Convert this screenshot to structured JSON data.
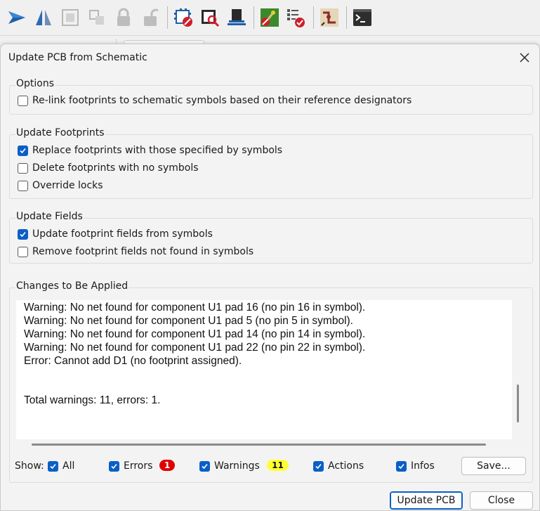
{
  "toolbar": {
    "icons": [
      "run-icon",
      "mirror-icon",
      "group-icon",
      "ungroup-icon",
      "lock-icon",
      "unlock-icon",
      "footprint-editor-icon",
      "footprint-browser-icon",
      "update-pcb-icon",
      "drc-icon",
      "board-setup-icon",
      "route-icon",
      "scripting-console-icon"
    ]
  },
  "dialog": {
    "title": "Update PCB from Schematic",
    "options": {
      "legend": "Options",
      "relink": {
        "label": "Re-link footprints to schematic symbols based on their reference designators",
        "checked": false
      }
    },
    "update_footprints": {
      "legend": "Update Footprints",
      "items": [
        {
          "label": "Replace footprints with those specified by symbols",
          "checked": true
        },
        {
          "label": "Delete footprints with no symbols",
          "checked": false
        },
        {
          "label": "Override locks",
          "checked": false
        }
      ]
    },
    "update_fields": {
      "legend": "Update Fields",
      "items": [
        {
          "label": "Update footprint fields from symbols",
          "checked": true
        },
        {
          "label": "Remove footprint fields not found in symbols",
          "checked": false
        }
      ]
    },
    "changes": {
      "legend": "Changes to Be Applied",
      "lines": [
        "Warning: No net found for component U1 pad 16 (no pin 16 in symbol).",
        "Warning: No net found for component U1 pad 5 (no pin 5 in symbol).",
        "Warning: No net found for component U1 pad 14 (no pin 14 in symbol).",
        "Warning: No net found for component U1 pad 22 (no pin 22 in symbol).",
        "Error: Cannot add D1 (no footprint assigned).",
        "Total warnings: 11, errors: 1."
      ]
    },
    "show": {
      "label": "Show:",
      "filters": [
        {
          "label": "All",
          "checked": true
        },
        {
          "label": "Errors",
          "checked": true
        },
        {
          "label": "Warnings",
          "checked": true
        },
        {
          "label": "Actions",
          "checked": true
        },
        {
          "label": "Infos",
          "checked": true
        }
      ],
      "errors_count": "1",
      "warnings_count": "11",
      "save_button": "Save..."
    },
    "buttons": {
      "update_pcb": "Update PCB",
      "close": "Close"
    },
    "colors": {
      "accent": "#0a5fc7",
      "error_badge": "#e00000",
      "warning_badge": "#ffff33"
    }
  }
}
